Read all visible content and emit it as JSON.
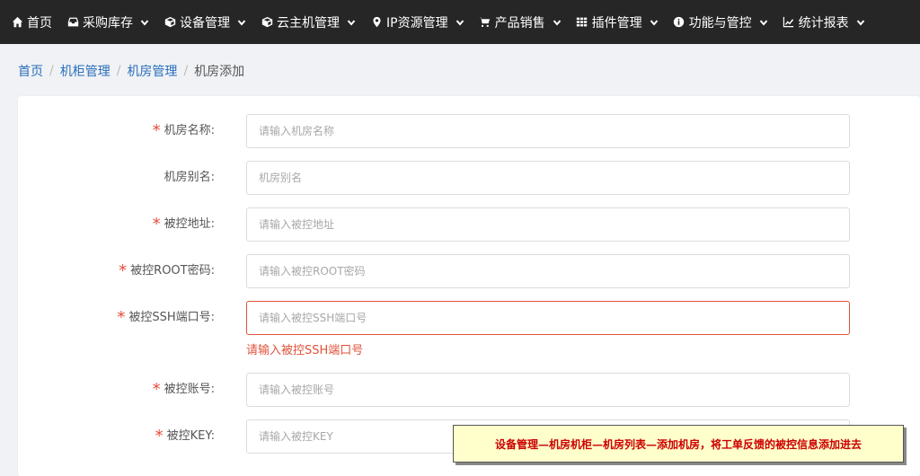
{
  "nav": {
    "items": [
      {
        "label": "首页",
        "icon": "home-icon",
        "dropdown": false
      },
      {
        "label": "采购库存",
        "icon": "inbox-icon",
        "dropdown": true
      },
      {
        "label": "设备管理",
        "icon": "cube-icon",
        "dropdown": true
      },
      {
        "label": "云主机管理",
        "icon": "cube-icon",
        "dropdown": true
      },
      {
        "label": "IP资源管理",
        "icon": "map-marker-icon",
        "dropdown": true
      },
      {
        "label": "产品销售",
        "icon": "cart-icon",
        "dropdown": true
      },
      {
        "label": "插件管理",
        "icon": "grid-icon",
        "dropdown": true
      },
      {
        "label": "功能与管控",
        "icon": "info-icon",
        "dropdown": true
      },
      {
        "label": "统计报表",
        "icon": "chart-line-icon",
        "dropdown": true
      }
    ]
  },
  "breadcrumb": {
    "items": [
      "首页",
      "机柜管理",
      "机房管理"
    ],
    "current": "机房添加"
  },
  "form": {
    "fields": [
      {
        "label": "机房名称:",
        "required": true,
        "placeholder": "请输入机房名称",
        "value": ""
      },
      {
        "label": "机房别名:",
        "required": false,
        "placeholder": "机房别名",
        "value": ""
      },
      {
        "label": "被控地址:",
        "required": true,
        "placeholder": "请输入被控地址",
        "value": ""
      },
      {
        "label": "被控ROOT密码:",
        "required": true,
        "placeholder": "请输入被控ROOT密码",
        "value": ""
      },
      {
        "label": "被控SSH端口号:",
        "required": true,
        "placeholder": "请输入被控SSH端口号",
        "value": "",
        "error": "请输入被控SSH端口号"
      },
      {
        "label": "被控账号:",
        "required": true,
        "placeholder": "请输入被控账号",
        "value": ""
      },
      {
        "label": "被控KEY:",
        "required": true,
        "placeholder": "请输入被控KEY",
        "value": ""
      }
    ]
  },
  "annotation": {
    "text": "设备管理—机房机柜—机房列表—添加机房，将工单反馈的被控信息添加进去",
    "color": "#cc0000",
    "background": "#ffffcc"
  },
  "colors": {
    "nav_bg": "#262626",
    "link": "#2a6ebb",
    "required": "#e74c3c",
    "error": "#e0533b"
  }
}
